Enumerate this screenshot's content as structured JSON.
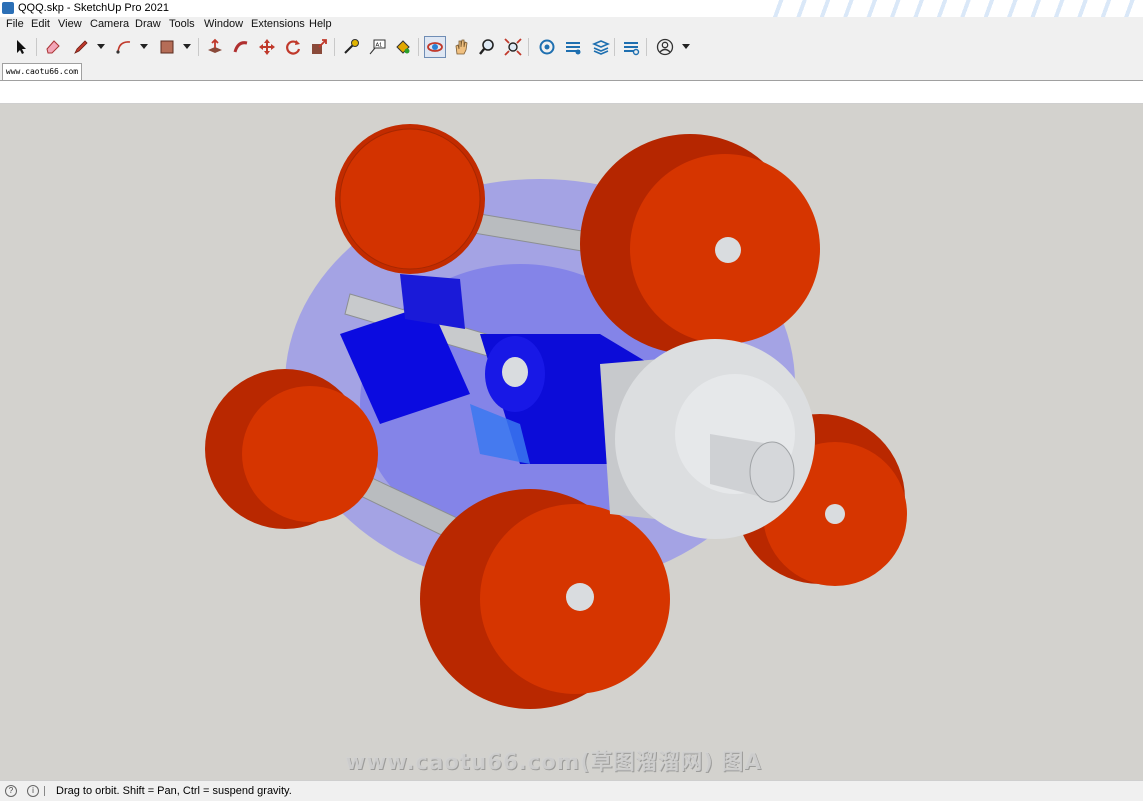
{
  "window": {
    "title": "QQQ.skp - SketchUp Pro 2021"
  },
  "menu": {
    "items": [
      "File",
      "Edit",
      "View",
      "Camera",
      "Draw",
      "Tools",
      "Window",
      "Extensions",
      "Help"
    ]
  },
  "tabs": [
    {
      "label": "www.caotu66.com"
    }
  ],
  "watermark": "www.caotu66.com(草图溜溜网) 图A",
  "status": {
    "text": "Drag to orbit. Shift = Pan, Ctrl = suspend gravity."
  },
  "colors": {
    "gear_red": "#cc3300",
    "gear_grey": "#d9dcdf",
    "housing_blue": "#1515d0",
    "viewport_bg": "#d3d2ce"
  }
}
